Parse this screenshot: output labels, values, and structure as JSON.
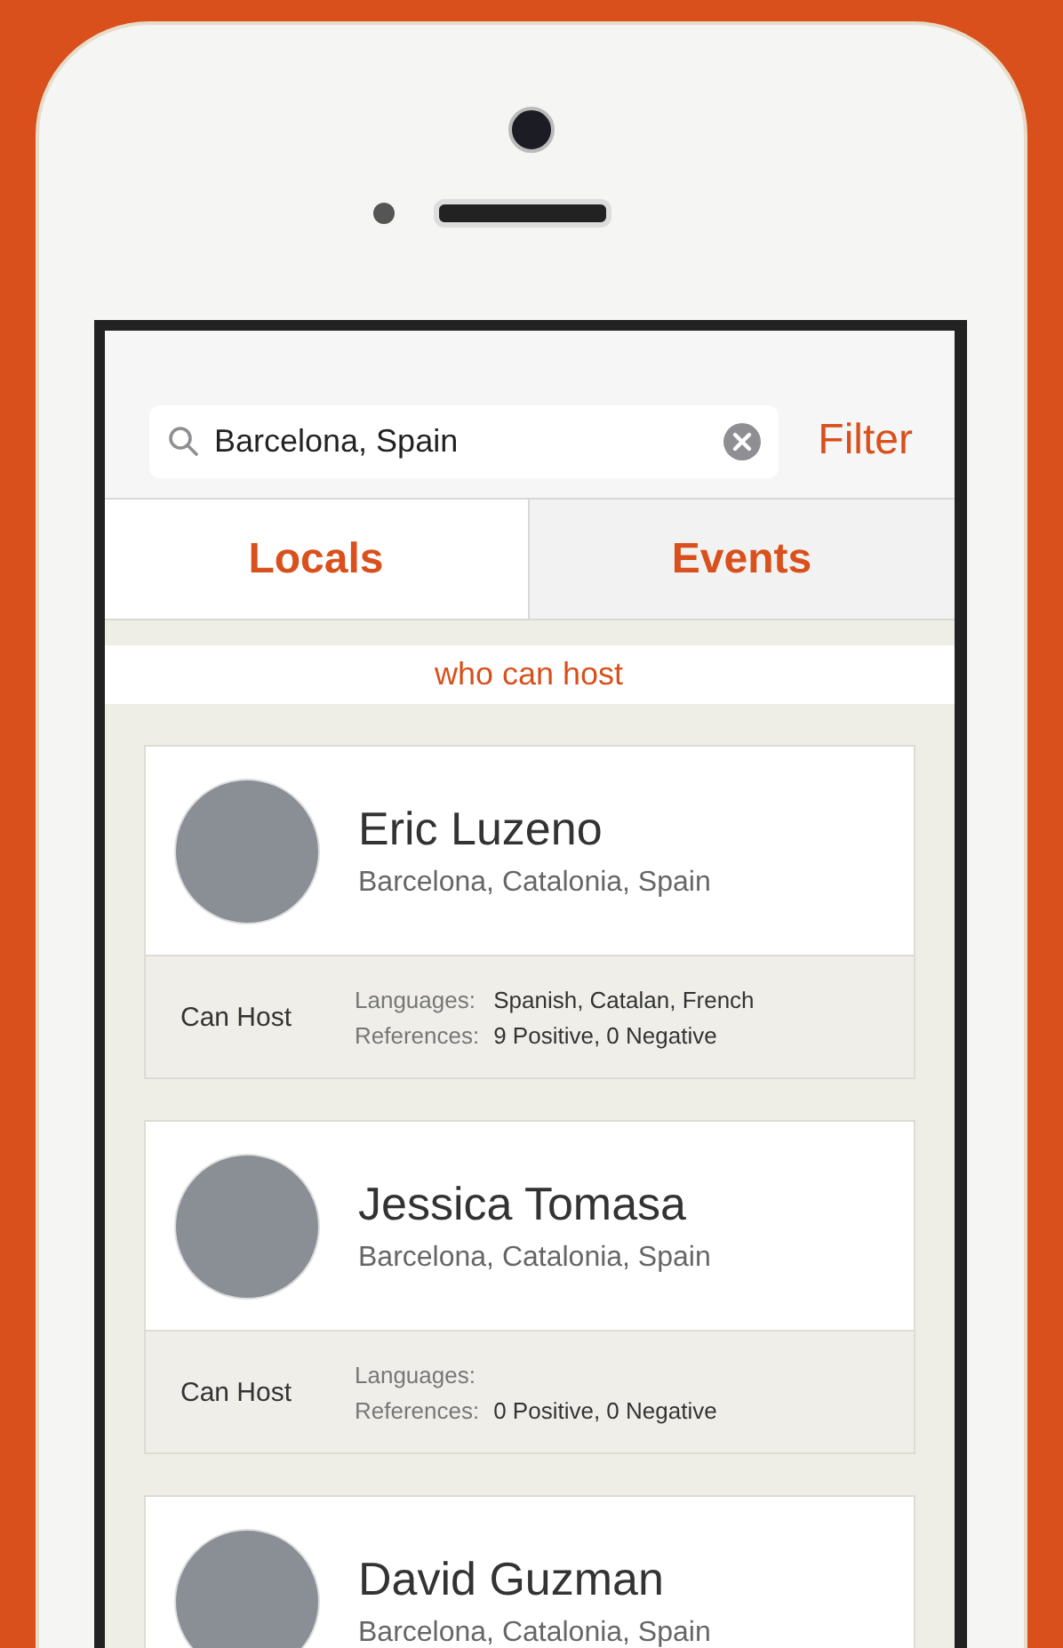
{
  "search": {
    "value": "Barcelona, Spain"
  },
  "filter_button": "Filter",
  "tabs": [
    {
      "label": "Locals",
      "selected": true
    },
    {
      "label": "Events",
      "selected": false
    }
  ],
  "banner": "who can host",
  "hosts": [
    {
      "name": "Eric Luzeno",
      "location": "Barcelona, Catalonia, Spain",
      "host_status": "Can Host",
      "languages_label": "Languages:",
      "languages": "Spanish, Catalan, French",
      "references_label": "References:",
      "references": "9 Positive, 0 Negative"
    },
    {
      "name": "Jessica Tomasa",
      "location": "Barcelona, Catalonia, Spain",
      "host_status": "Can Host",
      "languages_label": "Languages:",
      "references_label": "References:",
      "references": "0 Positive, 0 Negative"
    },
    {
      "name": "David Guzman",
      "location": "Barcelona, Catalonia, Spain"
    }
  ]
}
